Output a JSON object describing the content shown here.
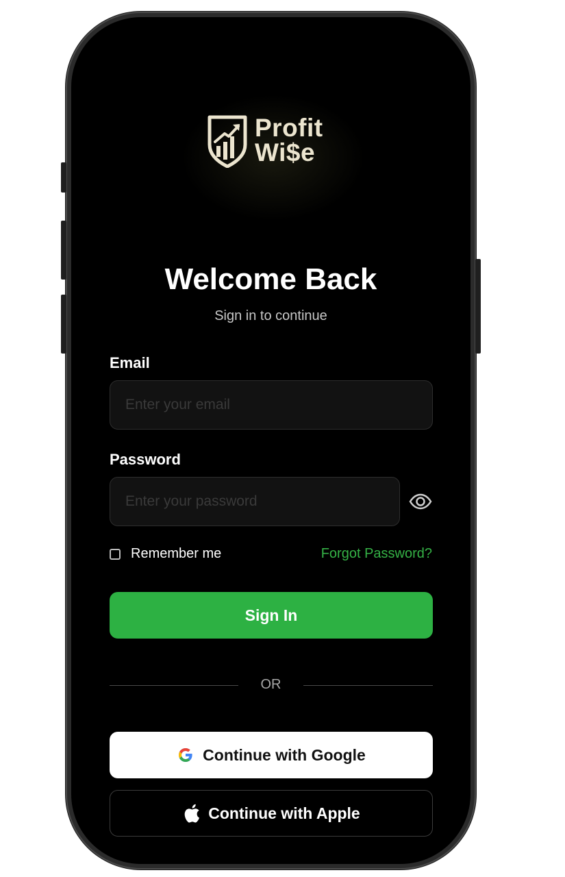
{
  "brand": {
    "logo_line1": "Profit",
    "logo_line2": "Wi$e",
    "logo_color": "#ece5cf"
  },
  "header": {
    "title": "Welcome Back",
    "subtitle": "Sign in to continue"
  },
  "form": {
    "email_label": "Email",
    "email_placeholder": "Enter your email",
    "email_value": "",
    "password_label": "Password",
    "password_placeholder": "Enter your password",
    "password_value": "",
    "password_toggle_icon": "eye-icon",
    "remember_label": "Remember me",
    "remember_checked": false,
    "forgot_label": "Forgot Password?"
  },
  "actions": {
    "signin_label": "Sign In",
    "divider_label": "OR",
    "google_label": "Continue with Google",
    "apple_label": "Continue with Apple"
  },
  "colors": {
    "accent": "#2db143",
    "link": "#35b246",
    "background": "#000000",
    "input_bg": "#121212"
  }
}
